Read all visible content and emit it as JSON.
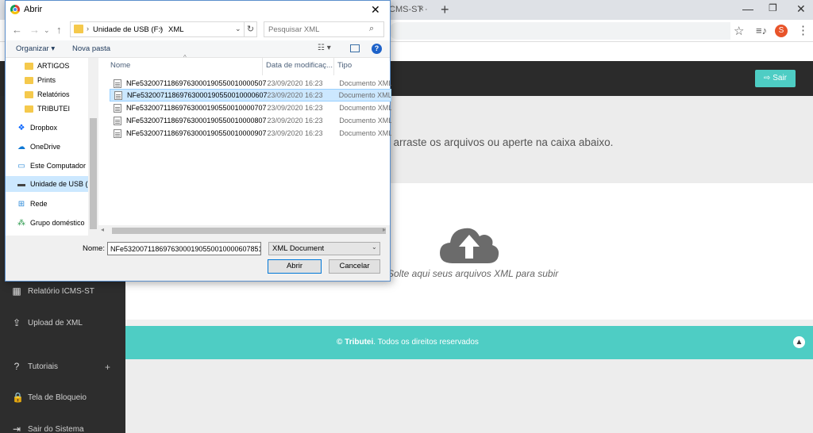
{
  "browser": {
    "tab_label": "CMS-ST ·",
    "tab_close": "×",
    "new_tab": "+",
    "profile_initial": "S"
  },
  "webpage": {
    "logout_label": "Sair",
    "sidebar": [
      {
        "label": "Relatório ICMS-ST",
        "icon": "calculator-icon",
        "glyph": "▦"
      },
      {
        "label": "Upload de XML",
        "icon": "upload-icon",
        "glyph": "⇪"
      },
      {
        "label": "Tutoriais",
        "icon": "question-icon",
        "glyph": "?"
      },
      {
        "label": "Tela de Bloqueio",
        "icon": "lock-icon",
        "glyph": "🔒"
      },
      {
        "label": "Sair do Sistema",
        "icon": "logout-icon",
        "glyph": "⇥"
      }
    ],
    "tutoriais_expand": "+",
    "instructions": ", arraste os arquivos ou aperte na caixa abaixo.",
    "drop_text": "Solte aqui seus arquivos XML para subir",
    "footer_brand": "© Tributei",
    "footer_rest": ". Todos os direitos reservados",
    "colors": {
      "accent": "#4ecdc4",
      "topbar": "#2b2b2b",
      "sidebar": "#2d2d2d"
    }
  },
  "dialog": {
    "title": "Abrir",
    "address": {
      "drive": "Unidade de USB (F:)",
      "folder": "XML"
    },
    "search_placeholder": "Pesquisar XML",
    "organize_label": "Organizar ▾",
    "new_folder_label": "Nova pasta",
    "help": "?",
    "nav_items": [
      {
        "label": "ARTIGOS",
        "kind": "folder",
        "sub": true
      },
      {
        "label": "Prints",
        "kind": "folder",
        "sub": true
      },
      {
        "label": "Relatórios",
        "kind": "folder",
        "sub": true
      },
      {
        "label": "TRIBUTEI",
        "kind": "folder",
        "sub": true
      },
      {
        "label": "Dropbox",
        "kind": "dropbox",
        "sub": false
      },
      {
        "label": "OneDrive",
        "kind": "cloud",
        "sub": false
      },
      {
        "label": "Este Computador",
        "kind": "pc",
        "sub": false
      },
      {
        "label": "Unidade de USB (F",
        "kind": "usb",
        "sub": false,
        "selected": true
      },
      {
        "label": "Rede",
        "kind": "network",
        "sub": false
      },
      {
        "label": "Grupo doméstico",
        "kind": "homegroup",
        "sub": false
      }
    ],
    "columns": {
      "name": "Nome",
      "date": "Data de modificaç...",
      "type": "Tipo"
    },
    "files": [
      {
        "name": "NFe53200711869763000190550010000507...",
        "date": "23/09/2020 16:23",
        "type": "Documento XML"
      },
      {
        "name": "NFe53200711869763000190550010000607...",
        "date": "23/09/2020 16:23",
        "type": "Documento XML",
        "selected": true
      },
      {
        "name": "NFe53200711869763000190550010000707...",
        "date": "23/09/2020 16:23",
        "type": "Documento XML"
      },
      {
        "name": "NFe53200711869763000190550010000807...",
        "date": "23/09/2020 16:23",
        "type": "Documento XML"
      },
      {
        "name": "NFe53200711869763000190550010000907...",
        "date": "23/09/2020 16:23",
        "type": "Documento XML"
      }
    ],
    "filename_label": "Nome:",
    "filename_value": "NFe53200711869763000190550010000607851",
    "filetype": "XML Document",
    "open_label": "Abrir",
    "cancel_label": "Cancelar"
  }
}
